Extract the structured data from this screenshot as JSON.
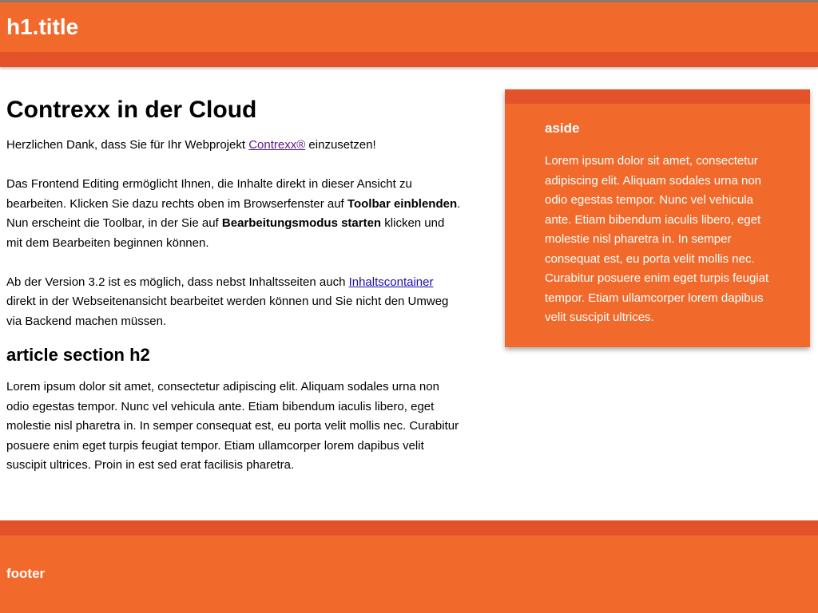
{
  "header": {
    "title": "h1.title"
  },
  "main": {
    "heading": "Contrexx in der Cloud",
    "p1": {
      "before": "Herzlichen Dank, dass Sie für Ihr Webprojekt ",
      "link": "Contrexx®",
      "after": " einzusetzen!"
    },
    "p2": {
      "t1": "Das Frontend Editing ermöglicht Ihnen, die Inhalte direkt in dieser Ansicht zu bearbeiten. Klicken Sie dazu rechts oben im Browserfenster auf ",
      "b1": "Toolbar einblenden",
      "t2": ". Nun erscheint die Toolbar, in der Sie auf ",
      "b2": "Bearbeitungsmodus starten",
      "t3": " klicken und mit dem Bearbeiten beginnen können."
    },
    "p3": {
      "before": "Ab der Version 3.2 ist es möglich, dass nebst Inhaltsseiten auch ",
      "link": "Inhaltscontainer",
      "after": " direkt in der Webseitenansicht bearbeitet werden können und Sie nicht den Umweg via Backend machen müssen."
    },
    "section_heading": "article section h2",
    "section_text": "Lorem ipsum dolor sit amet, consectetur adipiscing elit. Aliquam sodales urna non odio egestas tempor. Nunc vel vehicula ante. Etiam bibendum iaculis libero, eget molestie nisl pharetra in. In semper consequat est, eu porta velit mollis nec. Curabitur posuere enim eget turpis feugiat tempor. Etiam ullamcorper lorem dapibus velit suscipit ultrices. Proin in est sed erat facilisis pharetra."
  },
  "aside": {
    "title": "aside",
    "text": "Lorem ipsum dolor sit amet, consectetur adipiscing elit. Aliquam sodales urna non odio egestas tempor. Nunc vel vehicula ante. Etiam bibendum iaculis libero, eget molestie nisl pharetra in. In semper consequat est, eu porta velit mollis nec. Curabitur posuere enim eget turpis feugiat tempor. Etiam ullamcorper lorem dapibus velit suscipit ultrices."
  },
  "footer": {
    "title": "footer"
  },
  "colors": {
    "brand_orange": "#f26a2b",
    "band_orange": "#e4522a",
    "link": "#1a0dab",
    "link_visited": "#551a8b"
  }
}
